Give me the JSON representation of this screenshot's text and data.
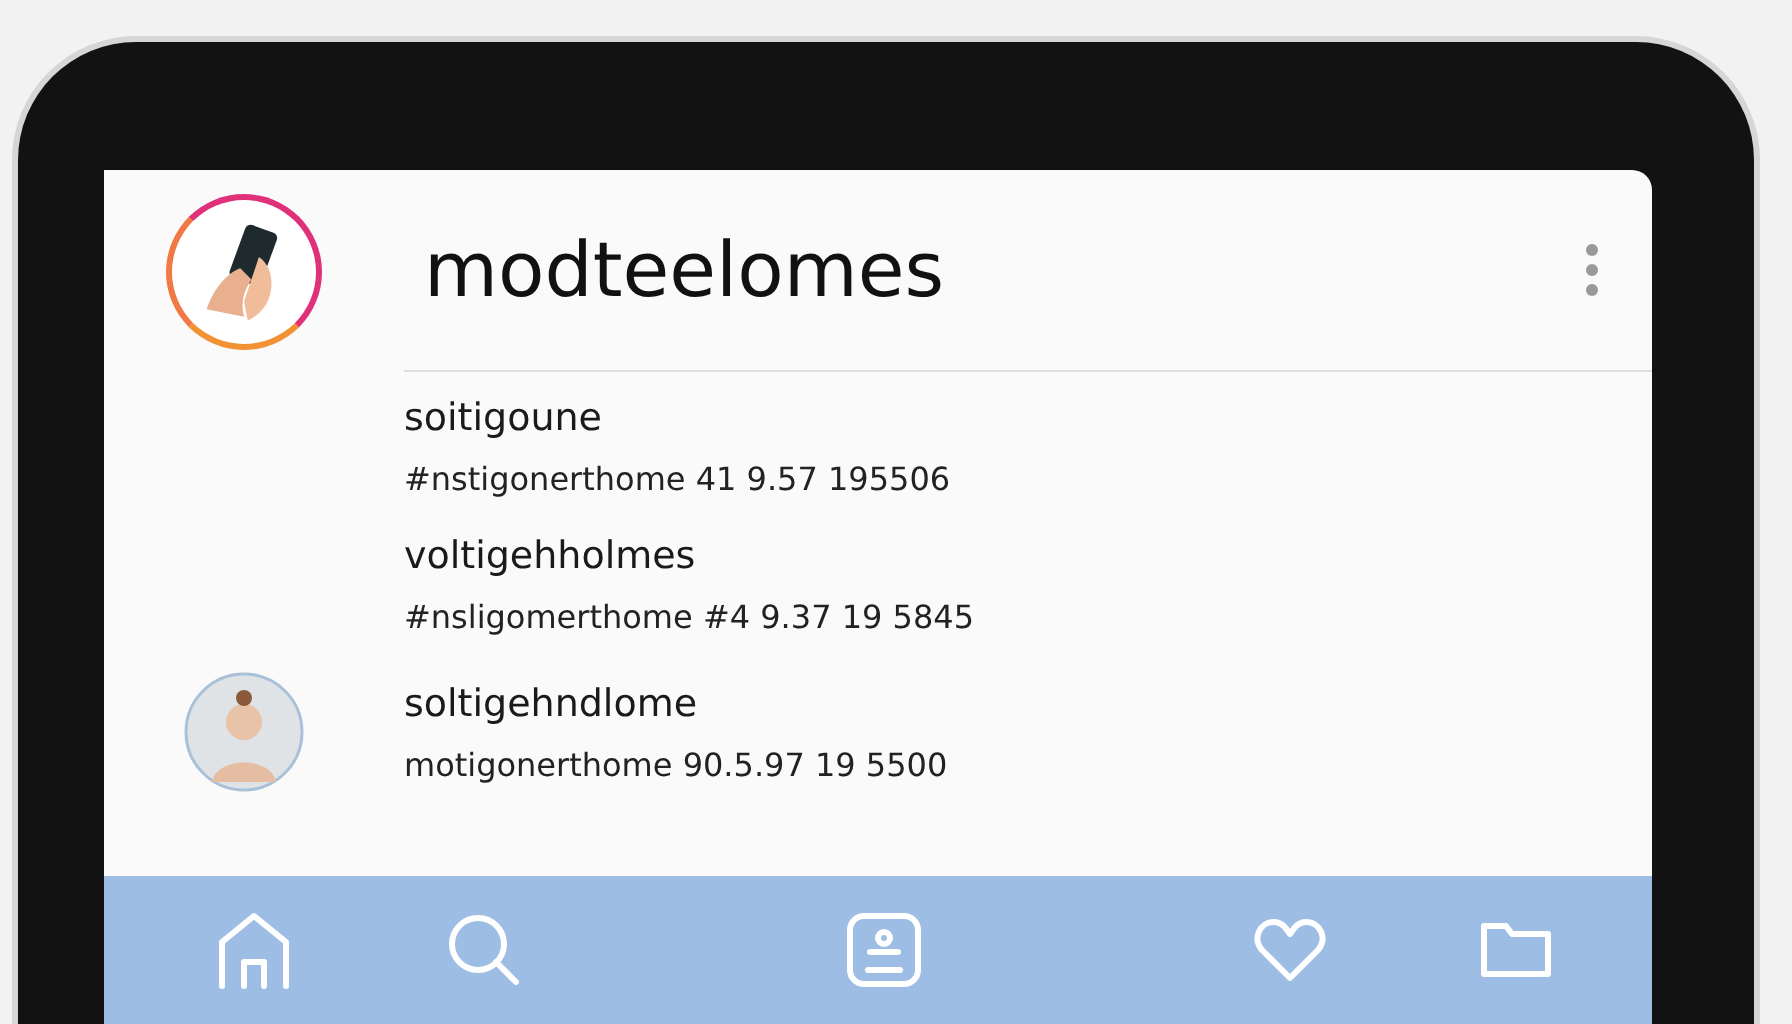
{
  "header": {
    "title": "modteelomes"
  },
  "posts": [
    {
      "name": "soitigoune",
      "caption": "#nstigonerthome 41 9.57 195506",
      "avatar": false
    },
    {
      "name": "voltigehholmes",
      "caption": "#nsligomerthome #4 9.37 19 5845",
      "avatar": false
    },
    {
      "name": "soltigehndlome",
      "caption": "motigonerthome 90.5.97 19 5500",
      "avatar": true
    }
  ],
  "nav": [
    {
      "kind": "home"
    },
    {
      "kind": "search"
    },
    {
      "kind": "camera"
    },
    {
      "kind": "heart"
    },
    {
      "kind": "folder"
    }
  ]
}
